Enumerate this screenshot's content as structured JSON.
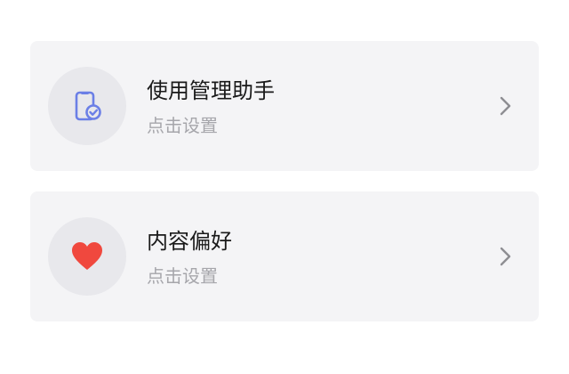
{
  "colors": {
    "background": "#ffffff",
    "card": "#f4f4f6",
    "icon_bg": "#e8e8ec",
    "title": "#1a1a1a",
    "subtitle": "#a6a6ab",
    "phone_icon": "#6b7fe6",
    "heart_icon": "#f0483e",
    "chevron": "#8e8e93"
  },
  "items": [
    {
      "title": "使用管理助手",
      "subtitle": "点击设置",
      "icon": "phone-check-icon"
    },
    {
      "title": "内容偏好",
      "subtitle": "点击设置",
      "icon": "heart-icon"
    }
  ]
}
